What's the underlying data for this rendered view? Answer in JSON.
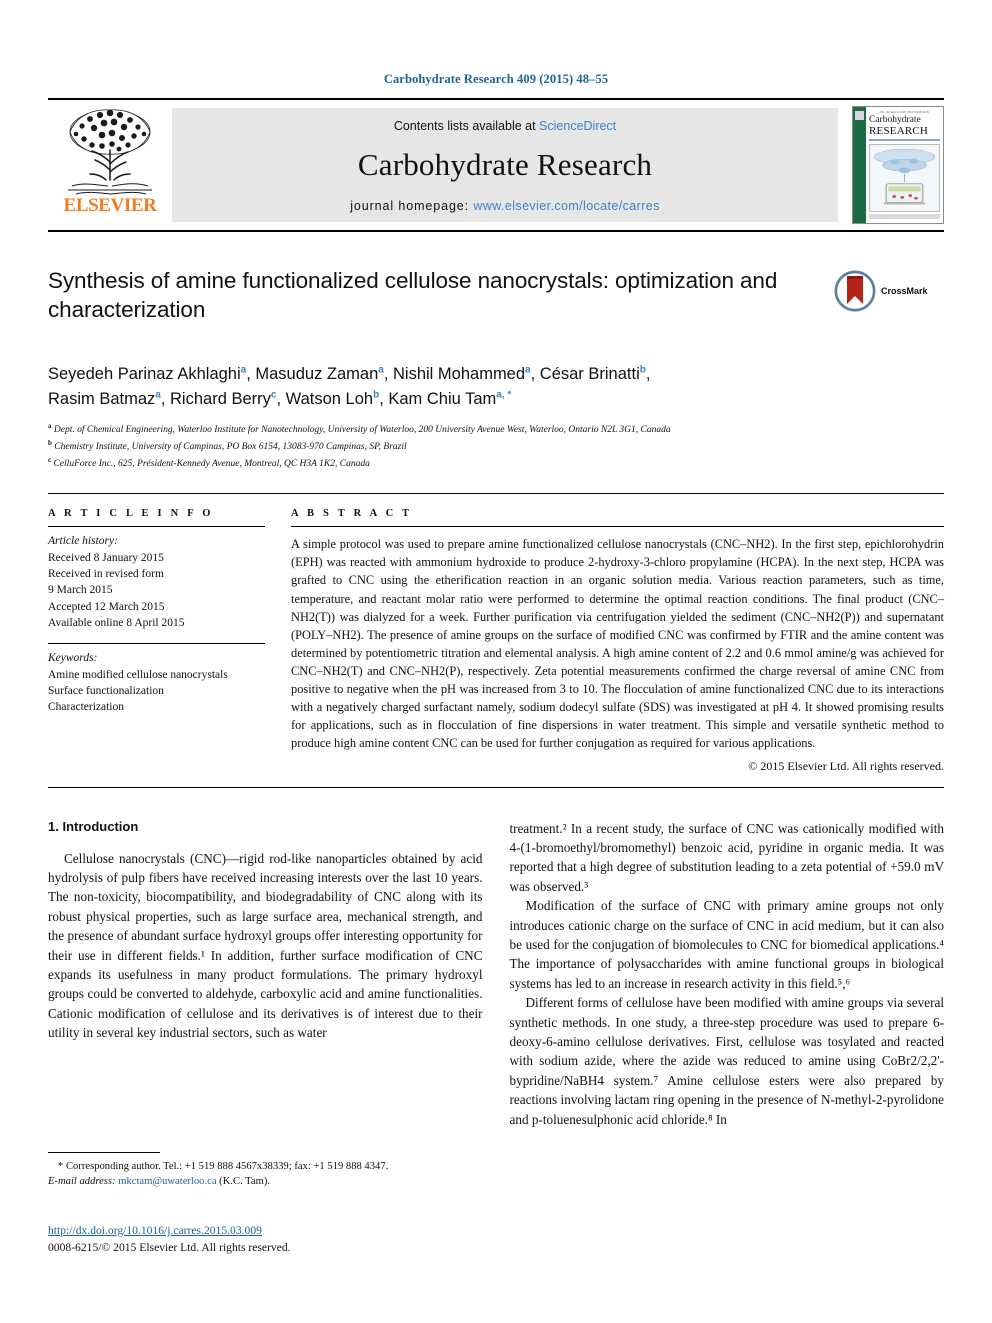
{
  "running_head": "Carbohydrate Research 409 (2015) 48–55",
  "masthead": {
    "publisher": "ELSEVIER",
    "contents_prefix": "Contents lists available at ",
    "contents_link": "ScienceDirect",
    "journal_title": "Carbohydrate Research",
    "homepage_prefix": "journal homepage: ",
    "homepage_link": "www.elsevier.com/locate/carres",
    "cover": {
      "top_line": "Vol. 4b  March 2015  ISSN 0008-6215",
      "title_line1": "Carbohydrate",
      "title_line2": "RESEARCH",
      "subtitle": "A International Journal of Carbohydrate Chemistry"
    }
  },
  "article": {
    "title": "Synthesis of amine functionalized cellulose nanocrystals: optimization and characterization",
    "crossmark_label": "CrossMark",
    "authors_line1": "Seyedeh Parinaz Akhlaghi ᵃ, Masuduz Zaman ᵃ, Nishil Mohammed ᵃ, César Brinatti ᵇ,",
    "authors_line2": "Rasim Batmaz ᵃ, Richard Berry ᶜ, Watson Loh ᵇ, Kam Chiu Tam ᵃ,*",
    "authors": [
      {
        "name": "Seyedeh Parinaz Akhlaghi",
        "mark": "a"
      },
      {
        "name": "Masuduz Zaman",
        "mark": "a"
      },
      {
        "name": "Nishil Mohammed",
        "mark": "a"
      },
      {
        "name": "César Brinatti",
        "mark": "b"
      },
      {
        "name": "Rasim Batmaz",
        "mark": "a"
      },
      {
        "name": "Richard Berry",
        "mark": "c"
      },
      {
        "name": "Watson Loh",
        "mark": "b"
      },
      {
        "name": "Kam Chiu Tam",
        "mark": "a,*"
      }
    ],
    "affiliations": [
      {
        "mark": "a",
        "text": "Dept. of Chemical Engineering, Waterloo Institute for Nanotechnology, University of Waterloo, 200 University Avenue West, Waterloo, Ontario N2L 3G1, Canada"
      },
      {
        "mark": "b",
        "text": "Chemistry Institute, University of Campinas, PO Box 6154, 13083-970 Campinas, SP, Brazil"
      },
      {
        "mark": "c",
        "text": "CelluForce Inc., 625, Président-Kennedy Avenue, Montreal, QC H3A 1K2, Canada"
      }
    ]
  },
  "article_info": {
    "heading": "A R T I C L E   I N F O",
    "history_label": "Article history:",
    "history": [
      "Received 8 January 2015",
      "Received in revised form",
      "9 March 2015",
      "Accepted 12 March 2015",
      "Available online 8 April 2015"
    ],
    "keywords_label": "Keywords:",
    "keywords": [
      "Amine modified cellulose nanocrystals",
      "Surface functionalization",
      "Characterization"
    ]
  },
  "abstract": {
    "heading": "A B S T R A C T",
    "text": "A simple protocol was used to prepare amine functionalized cellulose nanocrystals (CNC–NH2). In the first step, epichlorohydrin (EPH) was reacted with ammonium hydroxide to produce 2-hydroxy-3-chloro propylamine (HCPA). In the next step, HCPA was grafted to CNC using the etherification reaction in an organic solution media. Various reaction parameters, such as time, temperature, and reactant molar ratio were performed to determine the optimal reaction conditions. The final product (CNC–NH2(T)) was dialyzed for a week. Further purification via centrifugation yielded the sediment (CNC–NH2(P)) and supernatant (POLY–NH2). The presence of amine groups on the surface of modified CNC was confirmed by FTIR and the amine content was determined by potentiometric titration and elemental analysis. A high amine content of 2.2 and 0.6 mmol amine/g was achieved for CNC–NH2(T) and CNC–NH2(P), respectively. Zeta potential measurements confirmed the charge reversal of amine CNC from positive to negative when the pH was increased from 3 to 10. The flocculation of amine functionalized CNC due to its interactions with a negatively charged surfactant namely, sodium dodecyl sulfate (SDS) was investigated at pH 4. It showed promising results for applications, such as in flocculation of fine dispersions in water treatment. This simple and versatile synthetic method to produce high amine content CNC can be used for further conjugation as required for various applications.",
    "copyright": "© 2015 Elsevier Ltd. All rights reserved."
  },
  "body": {
    "section_heading": "1. Introduction",
    "left_paragraphs": [
      "Cellulose nanocrystals (CNC)—rigid rod-like nanoparticles obtained by acid hydrolysis of pulp fibers have received increasing interests over the last 10 years. The non-toxicity, biocompatibility, and biodegradability of CNC along with its robust physical properties, such as large surface area, mechanical strength, and the presence of abundant surface hydroxyl groups offer interesting opportunity for their use in different fields.¹ In addition, further surface modification of CNC expands its usefulness in many product formulations. The primary hydroxyl groups could be converted to aldehyde, carboxylic acid and amine functionalities. Cationic modification of cellulose and its derivatives is of interest due to their utility in several key industrial sectors, such as water"
    ],
    "right_paragraphs": [
      "treatment.² In a recent study, the surface of CNC was cationically modified with 4-(1-bromoethyl/bromomethyl) benzoic acid, pyridine in organic media. It was reported that a high degree of substitution leading to a zeta potential of +59.0 mV was observed.³",
      "Modification of the surface of CNC with primary amine groups not only introduces cationic charge on the surface of CNC in acid medium, but it can also be used for the conjugation of biomolecules to CNC for biomedical applications.⁴ The importance of polysaccharides with amine functional groups in biological systems has led to an increase in research activity in this field.⁵,⁶",
      "Different forms of cellulose have been modified with amine groups via several synthetic methods. In one study, a three-step procedure was used to prepare 6-deoxy-6-amino cellulose derivatives. First, cellulose was tosylated and reacted with sodium azide, where the azide was reduced to amine using CoBr2/2,2'-bypridine/NaBH4 system.⁷ Amine cellulose esters were also prepared by reactions involving lactam ring opening in the presence of N-methyl-2-pyrolidone and p-toluenesulphonic acid chloride.⁸ In"
    ]
  },
  "footer": {
    "corresponding_note": "* Corresponding author. Tel.: +1 519 888 4567x38339; fax: +1 519 888 4347.",
    "email_label": "E-mail address: ",
    "email": "mkctam@uwaterloo.ca",
    "email_owner": " (K.C. Tam).",
    "doi_url": "http://dx.doi.org/10.1016/j.carres.2015.03.009",
    "issn_line": "0008-6215/© 2015 Elsevier Ltd. All rights reserved."
  },
  "colors": {
    "link_blue": "#1a6496",
    "sciencedirect_blue": "#3a84c3",
    "elsevier_orange": "#ef7d20",
    "cover_green": "#1d6b43",
    "superscript_blue": "#3a84c3"
  }
}
